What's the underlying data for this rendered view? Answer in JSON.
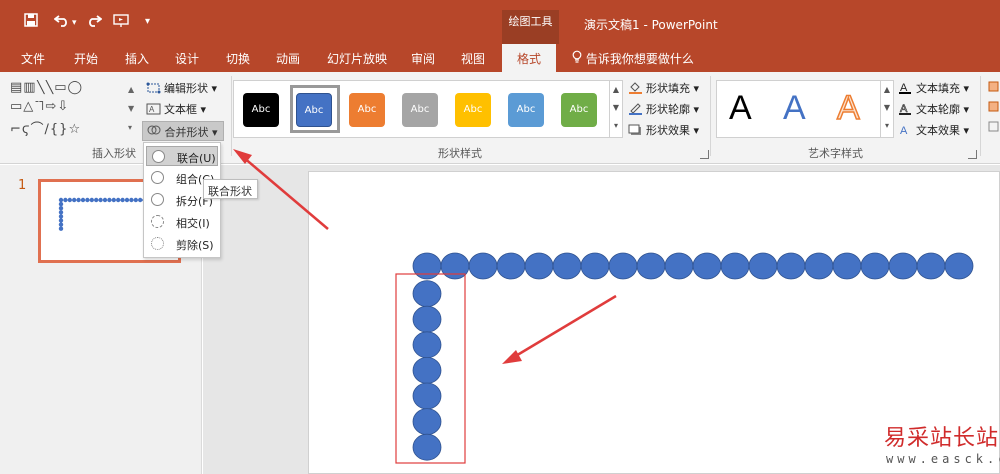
{
  "app": {
    "window_title": "演示文稿1 - PowerPoint",
    "contextual_tab_group": "绘图工具"
  },
  "quick_access": {
    "save_icon": "save-icon",
    "undo_icon": "undo-icon",
    "redo_icon": "redo-icon",
    "start_from_beginning_icon": "start-slideshow-icon",
    "customize_icon": "customize-toolbar-icon"
  },
  "tabs": [
    {
      "label": "文件"
    },
    {
      "label": "开始"
    },
    {
      "label": "插入"
    },
    {
      "label": "设计"
    },
    {
      "label": "切换"
    },
    {
      "label": "动画"
    },
    {
      "label": "幻灯片放映"
    },
    {
      "label": "审阅"
    },
    {
      "label": "视图"
    },
    {
      "label": "格式",
      "active": true
    }
  ],
  "tell_me": "告诉我你想要做什么",
  "ribbon": {
    "insert_shapes": {
      "edit_shape": "编辑形状",
      "text_box": "文本框",
      "merge_shapes": "合并形状",
      "group_label": "插入形状"
    },
    "shape_styles": {
      "swatches": [
        {
          "text": "Abc",
          "color": "#000000"
        },
        {
          "text": "Abc",
          "color": "#4472c4",
          "selected": true
        },
        {
          "text": "Abc",
          "color": "#ed7d31"
        },
        {
          "text": "Abc",
          "color": "#a5a5a5"
        },
        {
          "text": "Abc",
          "color": "#ffc000"
        },
        {
          "text": "Abc",
          "color": "#5b9bd5"
        },
        {
          "text": "Abc",
          "color": "#70ad47"
        }
      ],
      "shape_fill": "形状填充",
      "shape_outline": "形状轮廓",
      "shape_effects": "形状效果",
      "group_label": "形状样式"
    },
    "wordart": {
      "samples": [
        {
          "text": "A",
          "color": "#000000"
        },
        {
          "text": "A",
          "color": "#4472c4"
        },
        {
          "text": "A",
          "color": "#ed7d31"
        }
      ],
      "text_fill": "文本填充",
      "text_outline": "文本轮廓",
      "text_effects": "文本效果",
      "group_label": "艺术字样式"
    }
  },
  "merge_menu": {
    "items": [
      {
        "label": "联合(U)",
        "selected": true
      },
      {
        "label": "组合(C)"
      },
      {
        "label": "拆分(F)"
      },
      {
        "label": "相交(I)"
      },
      {
        "label": "剪除(S)"
      }
    ],
    "tooltip": "联合形状"
  },
  "thumbnail": {
    "slide_number": "1"
  },
  "watermark": {
    "title": "易采站长站",
    "url": "www.easck.com"
  },
  "colors": {
    "brand": "#b7472a",
    "shape_fill": "#4472c4",
    "annotation": "#e03c3c"
  }
}
